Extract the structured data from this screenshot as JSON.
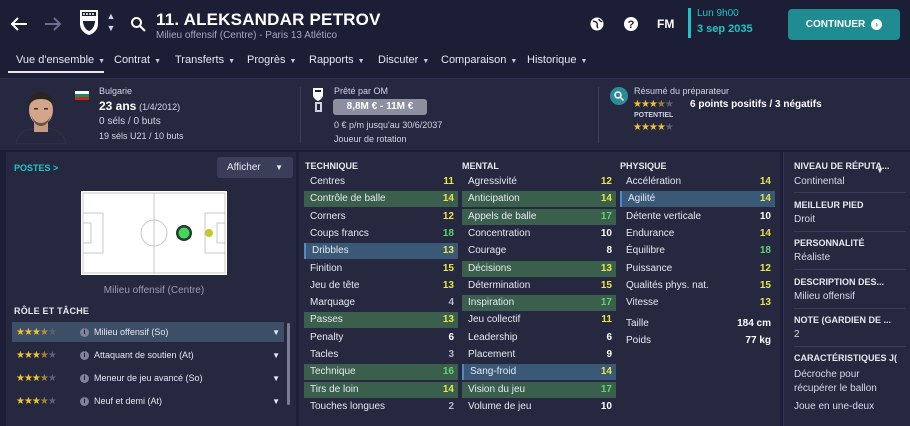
{
  "header": {
    "player_name": "11. ALEKSANDAR PETROV",
    "player_subtitle": "Milieu offensif (Centre) - Paris 13 Atlético",
    "fm_label": "FM",
    "date_time": "Lun 9h00",
    "date": "3 sep 2035",
    "continue_label": "CONTINUER",
    "icons": [
      "back-arrow-icon",
      "forward-arrow-icon",
      "club-crest-icon",
      "search-icon",
      "globe-icon",
      "help-icon"
    ]
  },
  "nav": {
    "items": [
      "Vue d'ensemble",
      "Contrat",
      "Transferts",
      "Progrès",
      "Rapports",
      "Discuter",
      "Comparaison",
      "Historique"
    ],
    "active_index": 0
  },
  "summary": {
    "nationality": "Bulgarie",
    "age": "23 ans",
    "birthdate": "(1/4/2012)",
    "caps": "0 séls / 0 buts",
    "u21": "19 séls U21 / 10 buts",
    "loan_label": "Prêté par OM",
    "value": "8,8M € - 11M €",
    "wage": "0 € p/m jusqu'au 30/6/2037",
    "squad_status": "Joueur de rotation",
    "scout_label": "Résumé du préparateur",
    "scout_summary": "6 points positifs / 3 négatifs",
    "potential_label": "POTENTIEL",
    "current_ability_stars": 3.5,
    "potential_stars": 4
  },
  "positions": {
    "title": "POSTES >",
    "show_label": "Afficher",
    "caption": "Milieu offensif (Centre)"
  },
  "roles": {
    "title": "RÔLE ET TÂCHE",
    "items": [
      {
        "name": "Milieu offensif (So)",
        "stars": 3.5,
        "selected": true
      },
      {
        "name": "Attaquant de soutien (At)",
        "stars": 3.5,
        "selected": false
      },
      {
        "name": "Meneur de jeu avancé (So)",
        "stars": 3.5,
        "selected": false
      },
      {
        "name": "Neuf et demi (At)",
        "stars": 3.5,
        "selected": false
      }
    ]
  },
  "attributes": {
    "technique": {
      "title": "TECHNIQUE",
      "rows": [
        {
          "label": "Centres",
          "value": "11",
          "hl": ""
        },
        {
          "label": "Contrôle de balle",
          "value": "14",
          "hl": "green"
        },
        {
          "label": "Corners",
          "value": "12",
          "hl": ""
        },
        {
          "label": "Coups francs",
          "value": "18",
          "hl": ""
        },
        {
          "label": "Dribbles",
          "value": "13",
          "hl": "blue"
        },
        {
          "label": "Finition",
          "value": "15",
          "hl": ""
        },
        {
          "label": "Jeu de tête",
          "value": "13",
          "hl": ""
        },
        {
          "label": "Marquage",
          "value": "4",
          "hl": ""
        },
        {
          "label": "Passes",
          "value": "13",
          "hl": "green"
        },
        {
          "label": "Penalty",
          "value": "6",
          "hl": ""
        },
        {
          "label": "Tacles",
          "value": "3",
          "hl": ""
        },
        {
          "label": "Technique",
          "value": "16",
          "hl": "green"
        },
        {
          "label": "Tirs de loin",
          "value": "14",
          "hl": "green"
        },
        {
          "label": "Touches longues",
          "value": "2",
          "hl": ""
        }
      ]
    },
    "mental": {
      "title": "MENTAL",
      "rows": [
        {
          "label": "Agressivité",
          "value": "12",
          "hl": ""
        },
        {
          "label": "Anticipation",
          "value": "14",
          "hl": "green"
        },
        {
          "label": "Appels de balle",
          "value": "17",
          "hl": "green"
        },
        {
          "label": "Concentration",
          "value": "10",
          "hl": ""
        },
        {
          "label": "Courage",
          "value": "8",
          "hl": ""
        },
        {
          "label": "Décisions",
          "value": "13",
          "hl": "green"
        },
        {
          "label": "Détermination",
          "value": "15",
          "hl": ""
        },
        {
          "label": "Inspiration",
          "value": "17",
          "hl": "green"
        },
        {
          "label": "Jeu collectif",
          "value": "11",
          "hl": ""
        },
        {
          "label": "Leadership",
          "value": "6",
          "hl": ""
        },
        {
          "label": "Placement",
          "value": "9",
          "hl": ""
        },
        {
          "label": "Sang-froid",
          "value": "14",
          "hl": "blue"
        },
        {
          "label": "Vision du jeu",
          "value": "17",
          "hl": "green"
        },
        {
          "label": "Volume de jeu",
          "value": "10",
          "hl": ""
        }
      ]
    },
    "physique": {
      "title": "PHYSIQUE",
      "rows": [
        {
          "label": "Accélération",
          "value": "14",
          "hl": ""
        },
        {
          "label": "Agilité",
          "value": "14",
          "hl": "blue"
        },
        {
          "label": "Détente verticale",
          "value": "10",
          "hl": ""
        },
        {
          "label": "Endurance",
          "value": "14",
          "hl": ""
        },
        {
          "label": "Équilibre",
          "value": "18",
          "hl": ""
        },
        {
          "label": "Puissance",
          "value": "12",
          "hl": ""
        },
        {
          "label": "Qualités phys. nat.",
          "value": "15",
          "hl": ""
        },
        {
          "label": "Vitesse",
          "value": "13",
          "hl": ""
        }
      ],
      "height_label": "Taille",
      "height_value": "184 cm",
      "weight_label": "Poids",
      "weight_value": "77 kg"
    }
  },
  "info": {
    "reputation_title": "NIVEAU DE RÉPUTA...",
    "reputation": "Continental",
    "foot_title": "MEILLEUR PIED",
    "foot": "Droit",
    "personality_title": "PERSONNALITÉ",
    "personality": "Réaliste",
    "desc_title": "DESCRIPTION DES...",
    "desc": "Milieu offensif",
    "gk_title": "NOTE (GARDIEN DE ...",
    "gk": "2",
    "traits_title": "CARACTÉRISTIQUES J(",
    "trait1": "Décroche pour",
    "trait2": "récupérer le ballon",
    "trait3": "Joue en une-deux"
  },
  "colors": {
    "background": "#1d1f38",
    "panel": "#25283f",
    "accent": "#1fc3c8",
    "continue_button": "#1e8c91",
    "stat_high": "#5ed56f",
    "stat_mid": "#e9e548",
    "highlight_green": "#3a5f4c",
    "highlight_blue": "#3a5977"
  }
}
